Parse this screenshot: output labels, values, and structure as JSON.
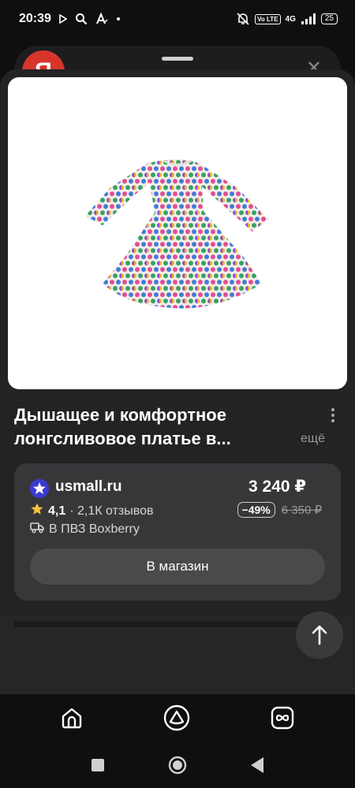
{
  "status_bar": {
    "time": "20:39",
    "network_badge": "Vo LTE",
    "generation": "4G",
    "battery": "25"
  },
  "background_app": {
    "logo_letter": "Я"
  },
  "product": {
    "title": "Дышащее и комфортное лонгсливовое платье в...",
    "more_label": "ещё",
    "image_icon": "polka-dot-dress"
  },
  "offer": {
    "shop_name": "usmall.ru",
    "rating": "4,1",
    "reviews": "· 2,1К отзывов",
    "delivery": "В ПВЗ Boxberry",
    "price": "3 240 ₽",
    "discount": "−49%",
    "old_price": "6 350 ₽",
    "button_label": "В магазин"
  },
  "colors": {
    "sheet": "#232325",
    "card": "#37373a",
    "button": "#4a4a4d",
    "accent_star": "#f7c43b"
  }
}
